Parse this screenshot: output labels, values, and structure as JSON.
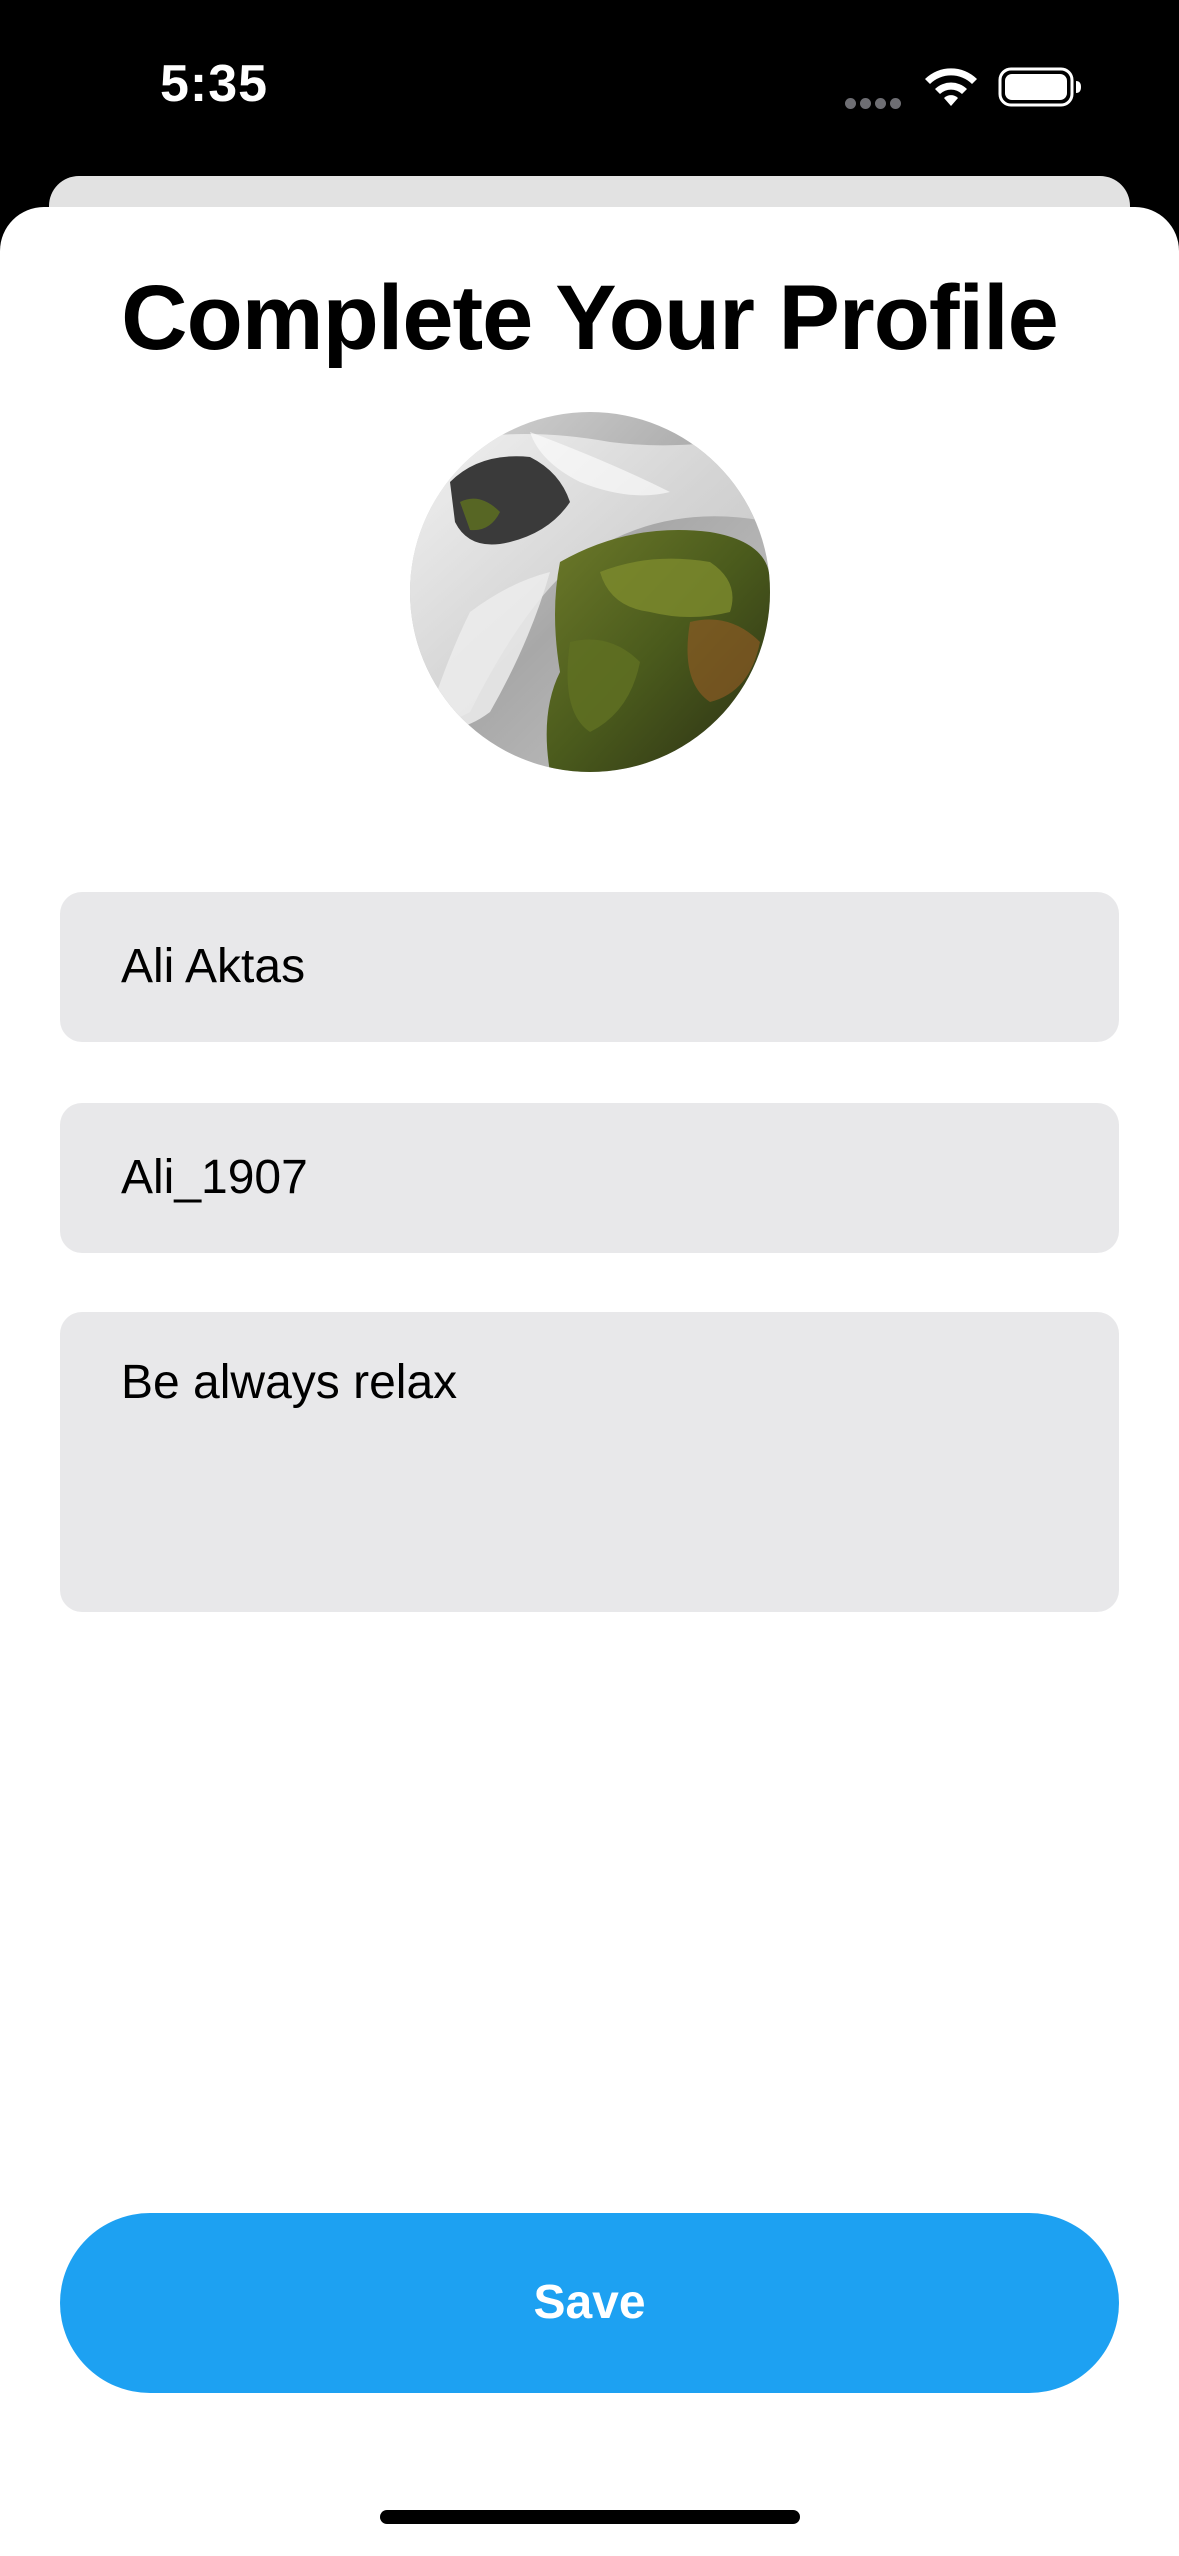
{
  "status_bar": {
    "time": "5:35",
    "icons": [
      "cellular-dots-icon",
      "wifi-icon",
      "battery-icon"
    ]
  },
  "screen": {
    "title": "Complete Your Profile",
    "avatar_icon": "profile-photo-waterfall"
  },
  "form": {
    "full_name": "Ali Aktas",
    "username": "Ali_1907",
    "bio": "Be always relax"
  },
  "actions": {
    "save_label": "Save"
  },
  "colors": {
    "accent": "#1da1f2",
    "field_background": "#e8e8ea",
    "sheet_background": "#ffffff",
    "status_bar_background": "#000000"
  }
}
